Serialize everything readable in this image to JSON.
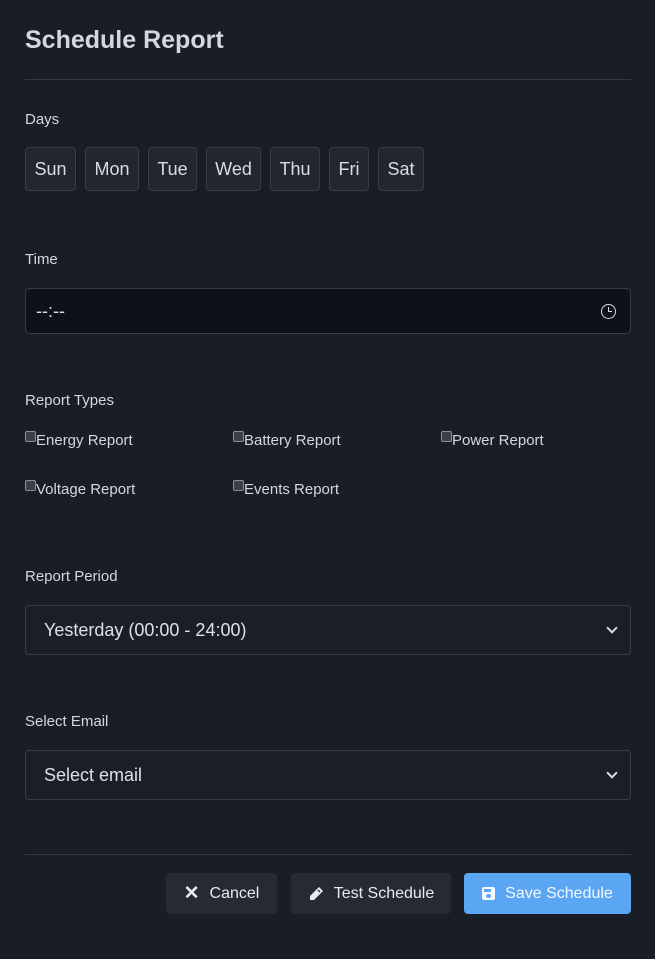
{
  "dialog": {
    "title": "Schedule Report"
  },
  "days": {
    "label": "Days",
    "items": [
      "Sun",
      "Mon",
      "Tue",
      "Wed",
      "Thu",
      "Fri",
      "Sat"
    ]
  },
  "time": {
    "label": "Time",
    "value": "--:--",
    "icon": "clock-icon"
  },
  "report_types": {
    "label": "Report Types",
    "options": [
      {
        "label": "Energy Report",
        "checked": false
      },
      {
        "label": "Battery Report",
        "checked": false
      },
      {
        "label": "Power Report",
        "checked": false
      },
      {
        "label": "Voltage Report",
        "checked": false
      },
      {
        "label": "Events Report",
        "checked": false
      }
    ]
  },
  "report_period": {
    "label": "Report Period",
    "selected": "Yesterday (00:00 - 24:00)"
  },
  "email": {
    "label": "Select Email",
    "selected": "Select email"
  },
  "actions": {
    "cancel": "Cancel",
    "test": "Test Schedule",
    "save": "Save Schedule"
  },
  "colors": {
    "background": "#191d26",
    "primary": "#5aa6f2",
    "input_bg": "#0e1118"
  }
}
